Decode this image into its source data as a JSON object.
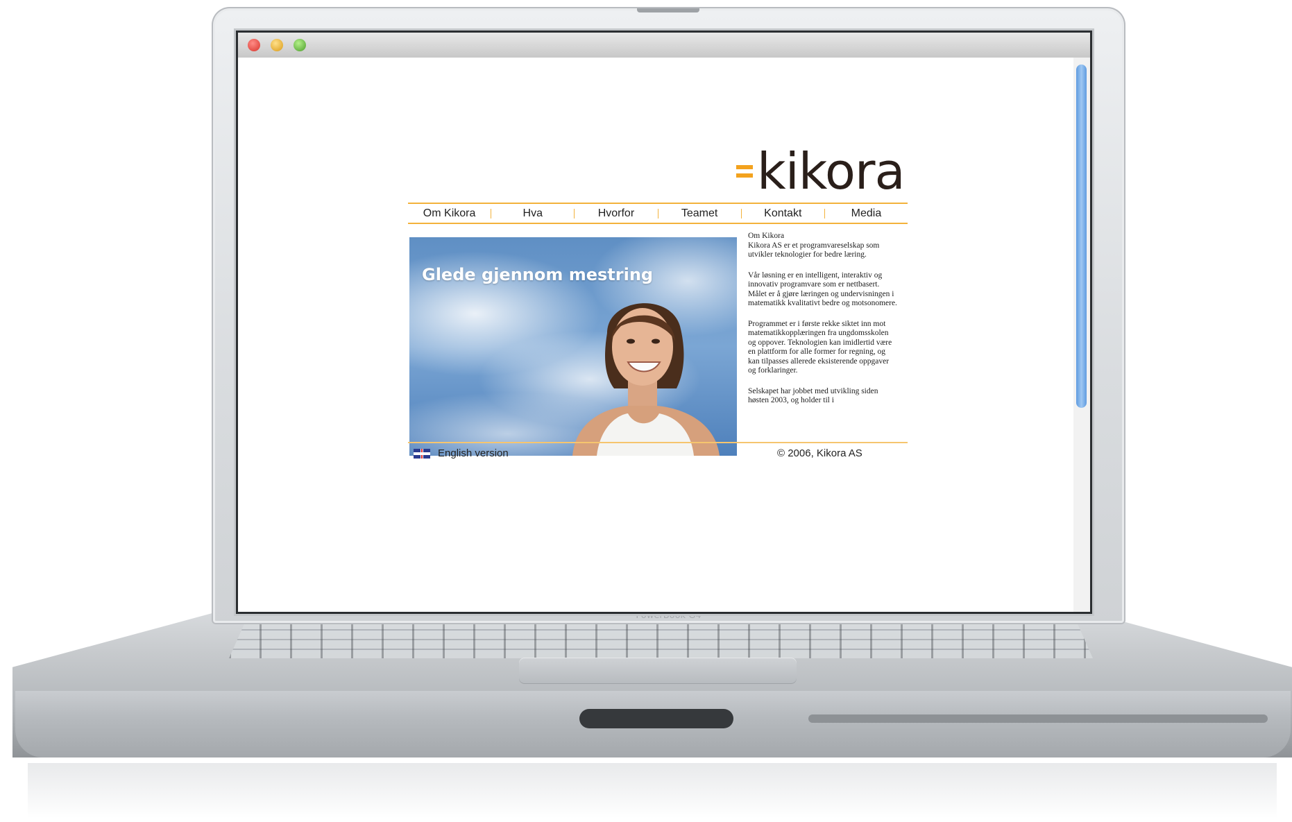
{
  "device": {
    "model_label": "PowerBook G4"
  },
  "window": {
    "controls": [
      "close-icon",
      "minimize-icon",
      "maximize-icon"
    ]
  },
  "site": {
    "logo_text": "kikora",
    "nav": [
      {
        "label": "Om Kikora"
      },
      {
        "label": "Hva"
      },
      {
        "label": "Hvorfor"
      },
      {
        "label": "Teamet"
      },
      {
        "label": "Kontakt"
      },
      {
        "label": "Media"
      }
    ],
    "hero": {
      "caption": "Glede gjennom mestring"
    },
    "content": {
      "heading": "Om Kikora",
      "paragraphs": [
        "Kikora AS er et programvareselskap som utvikler teknologier for bedre læring.",
        "Vår løsning er en intelligent, interaktiv og innovativ programvare som er nettbasert. Målet er å gjøre læringen og undervisningen i matematikk kvalitativt bedre og motsonomere.",
        "Programmet er i første rekke siktet inn mot matematikkopplæringen fra ungdomsskolen og oppover. Teknologien kan imidlertid være en plattform for alle former for regning, og kan tilpasses allerede eksisterende oppgaver og forklaringer.",
        "Selskapet har jobbet med utvikling siden høsten 2003, og holder til i"
      ]
    },
    "footer": {
      "english_link": "English version",
      "copyright": "© 2006, Kikora AS"
    },
    "colors": {
      "accent": "#f3b23b",
      "logo_mark": "#f3a21e",
      "logo_text": "#2a1f1a"
    }
  }
}
